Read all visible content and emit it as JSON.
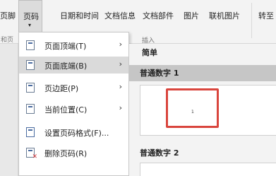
{
  "ribbon": {
    "left_cut_label": "页脚",
    "page_number_label": "页码",
    "date_time_label": "日期和时间",
    "doc_info_label": "文档信息",
    "doc_parts_label": "文档部件",
    "picture_label": "图片",
    "online_picture_label": "联机图片",
    "goto_label": "转至",
    "insert_group_label": "插入",
    "left_group_label": "和页"
  },
  "menu": {
    "items": [
      {
        "label": "页面顶端(T)",
        "has_submenu": true
      },
      {
        "label": "页面底端(B)",
        "has_submenu": true
      },
      {
        "label": "页边距(P)",
        "has_submenu": true
      },
      {
        "label": "当前位置(C)",
        "has_submenu": true
      },
      {
        "label": "设置页码格式(F)...",
        "has_submenu": false
      },
      {
        "label": "删除页码(R)",
        "has_submenu": false
      }
    ],
    "highlighted_index": 1,
    "submenu_arrow": "›"
  },
  "submenu": {
    "header": "简单",
    "option1": "普通数字 1",
    "preview_number": "1",
    "option2": "普通数字 2"
  },
  "colors": {
    "highlight_box": "#d9453d",
    "menu_highlight": "#dadada",
    "selected_option": "#c6c6c6"
  }
}
